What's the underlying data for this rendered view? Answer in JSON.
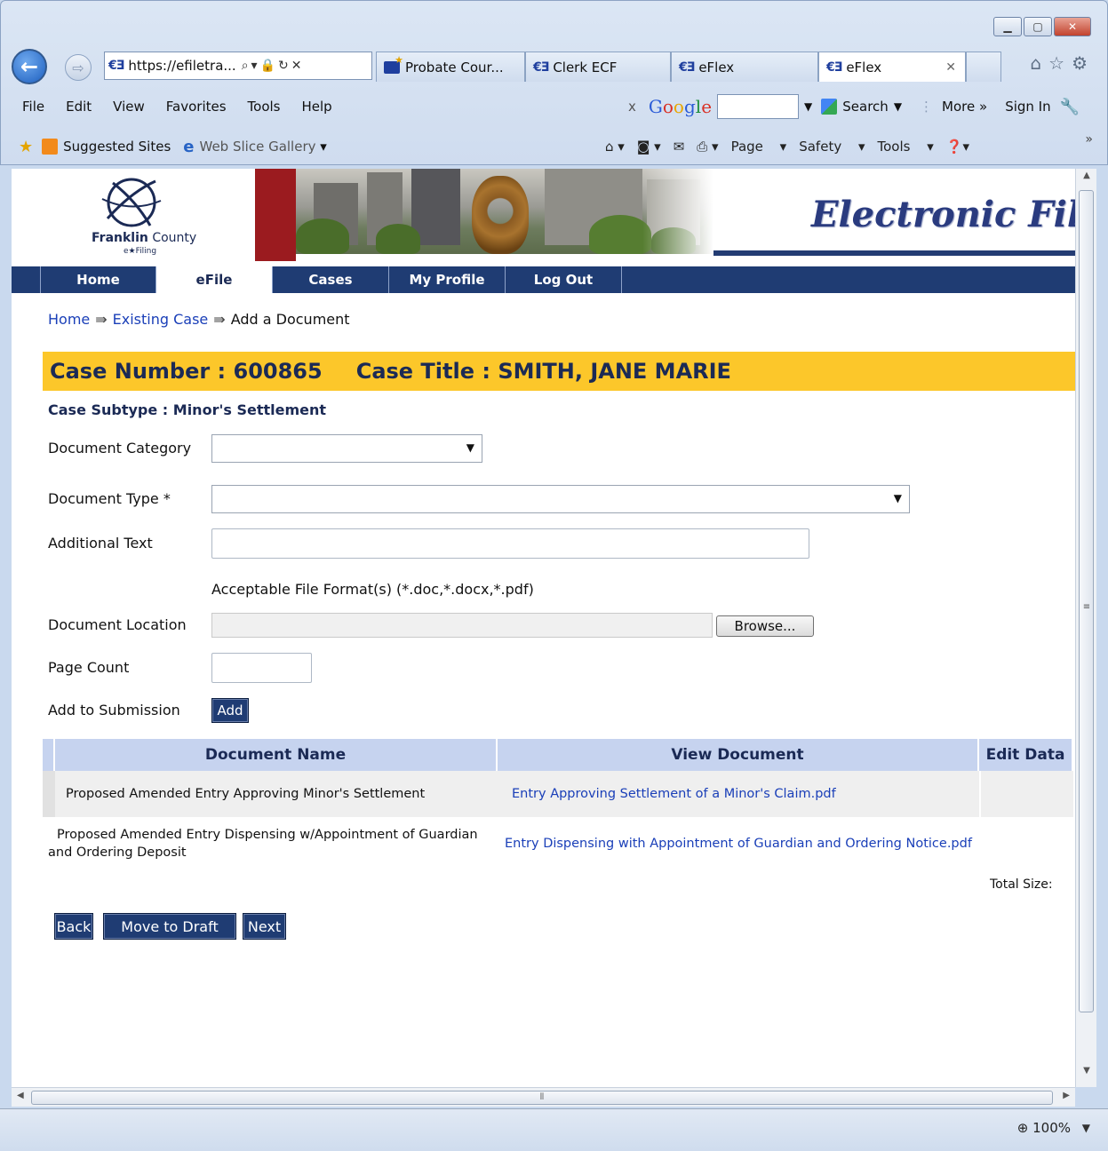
{
  "browser": {
    "address": "https://efiletra...",
    "tabs": [
      {
        "label": "Probate Cour..."
      },
      {
        "label": "Clerk ECF"
      },
      {
        "label": "eFlex"
      },
      {
        "label": "eFlex"
      }
    ],
    "menu": [
      "File",
      "Edit",
      "View",
      "Favorites",
      "Tools",
      "Help"
    ],
    "google": {
      "close": "x",
      "search_label": "Search",
      "more_label": "More »",
      "signin_label": "Sign In"
    },
    "favorites": {
      "suggested": "Suggested Sites",
      "webslice": "Web Slice Gallery"
    },
    "command_bar": {
      "page": "Page",
      "safety": "Safety",
      "tools": "Tools"
    },
    "zoom": "100%",
    "icons": {
      "back": "back-arrow-icon",
      "forward": "forward-arrow-icon",
      "home": "home-icon",
      "favorites": "star-icon",
      "settings": "gear-icon"
    }
  },
  "site": {
    "logo_name": "Franklin",
    "logo_county": "County",
    "logo_sub": "e★Filing",
    "banner_title": "Electronic Fili",
    "nav": [
      {
        "label": "Home",
        "selected": false
      },
      {
        "label": "eFile",
        "selected": true
      },
      {
        "label": "Cases",
        "selected": false
      },
      {
        "label": "My Profile",
        "selected": false
      },
      {
        "label": "Log Out",
        "selected": false
      }
    ]
  },
  "breadcrumb": {
    "home": "Home",
    "sep": "⇛",
    "existing": "Existing Case",
    "current": "Add a Document"
  },
  "case": {
    "number_label": "Case Number : 600865",
    "title_label": "Case Title : SMITH, JANE MARIE",
    "subtype_label": "Case Subtype : Minor's Settlement"
  },
  "form": {
    "category_label": "Document Category",
    "category_value": "",
    "type_label": "Document Type *",
    "type_value": "",
    "additional_label": "Additional Text",
    "additional_value": "",
    "formats": "Acceptable File Format(s) (*.doc,*.docx,*.pdf)",
    "location_label": "Document Location",
    "browse_label": "Browse...",
    "page_count_label": "Page Count",
    "page_count_value": "",
    "add_to_label": "Add to Submission",
    "add_button": "Add"
  },
  "table": {
    "headers": [
      "Document Name",
      "View Document",
      "Edit Data"
    ],
    "rows": [
      {
        "name": "Proposed Amended Entry Approving Minor's Settlement",
        "file": "Entry Approving Settlement of a Minor's Claim.pdf"
      },
      {
        "name": "Proposed Amended Entry Dispensing w/Appointment of Guardian and Ordering Deposit",
        "file": "Entry Dispensing with Appointment of Guardian and Ordering Notice.pdf"
      }
    ],
    "total_label": "Total Size:"
  },
  "actions": {
    "back": "Back",
    "draft": "Move to Draft",
    "next": "Next"
  },
  "colors": {
    "nav": "#1f3c73",
    "case_bar": "#fcc72a",
    "header_cell": "#c6d3ef",
    "link": "#1a3fb8"
  }
}
